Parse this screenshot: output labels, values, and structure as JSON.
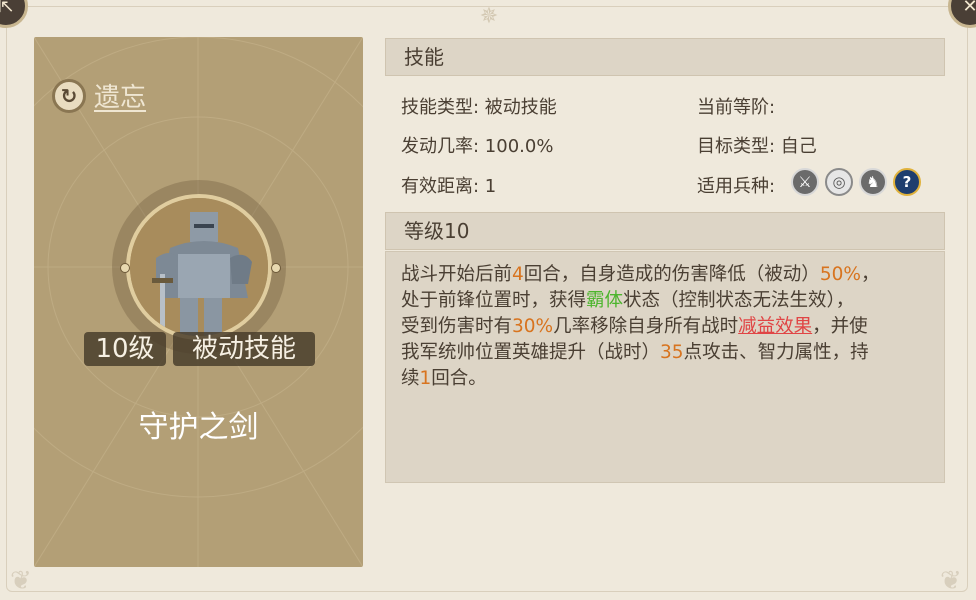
{
  "header": {
    "compass_icon": "compass-icon"
  },
  "controls": {
    "back_icon": "exit-icon",
    "close_icon": "close-icon"
  },
  "card": {
    "forget_label": "遗忘",
    "level_tag": "10级",
    "type_tag": "被动技能",
    "skill_name": "守护之剑"
  },
  "skill_section": {
    "title": "技能",
    "type_label": "技能类型: 被动技能",
    "rate_label": "发动几率: 100.0%",
    "range_label": "有效距离: 1",
    "grade_label": "当前等阶:",
    "target_label": "目标类型: 自己",
    "units_label": "适用兵种:",
    "unit_icons": [
      "sword-unit-icon",
      "bow-target-unit-icon",
      "horse-unit-icon",
      "question-unit-icon"
    ]
  },
  "level_section": {
    "title": "等级10",
    "description": {
      "l1a": "战斗开始后前",
      "l1n": "4",
      "l1b": "回合，自身造成的伤害降低（被动）",
      "l1p": "50%",
      "l1c": "，",
      "l2a": "处于前锋位置时，获得",
      "l2g": "霸体",
      "l2b": "状态（控制状态无法生效），",
      "l3a": "受到伤害时有",
      "l3p": "30%",
      "l3b": "几率移除自身所有战时",
      "l3r": "减益效果",
      "l3c": "，并使",
      "l4a": "我军统帅位置英雄提升（战时）",
      "l4n": "35",
      "l4b": "点攻击、智力属性，持",
      "l5a": "续",
      "l5n": "1",
      "l5b": "回合。"
    }
  },
  "colors": {
    "highlight_number": "#d8741f",
    "status_green": "#4cb52d",
    "debuff_red": "#e04545",
    "card_bg": "#b39f76"
  }
}
